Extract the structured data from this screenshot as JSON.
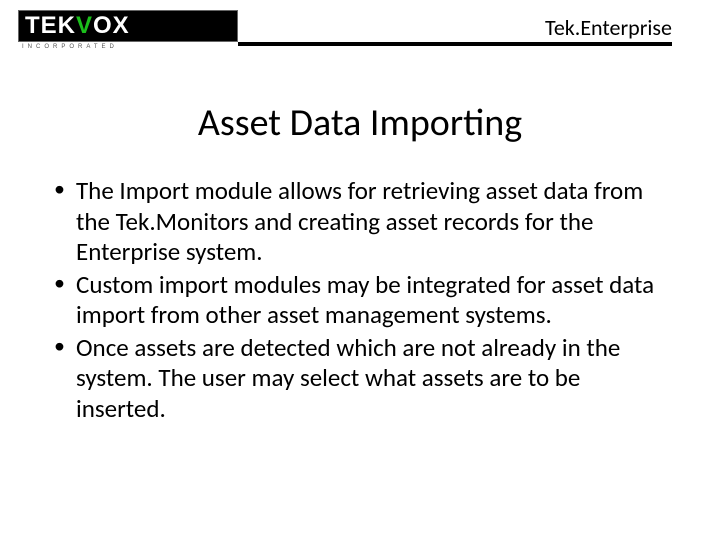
{
  "header": {
    "logo_tek": "TEK",
    "logo_v": "V",
    "logo_ox": "OX",
    "logo_sub": "INCORPORATED",
    "product": "Tek.Enterprise"
  },
  "title": "Asset Data Importing",
  "bullets": [
    "The Import module allows for retrieving asset data from the Tek.Monitors and creating asset records for the Enterprise system.",
    "Custom import modules may be integrated for asset data import from other asset management systems.",
    "Once assets are detected which are not already in the system.  The user may select what assets are to be inserted."
  ]
}
